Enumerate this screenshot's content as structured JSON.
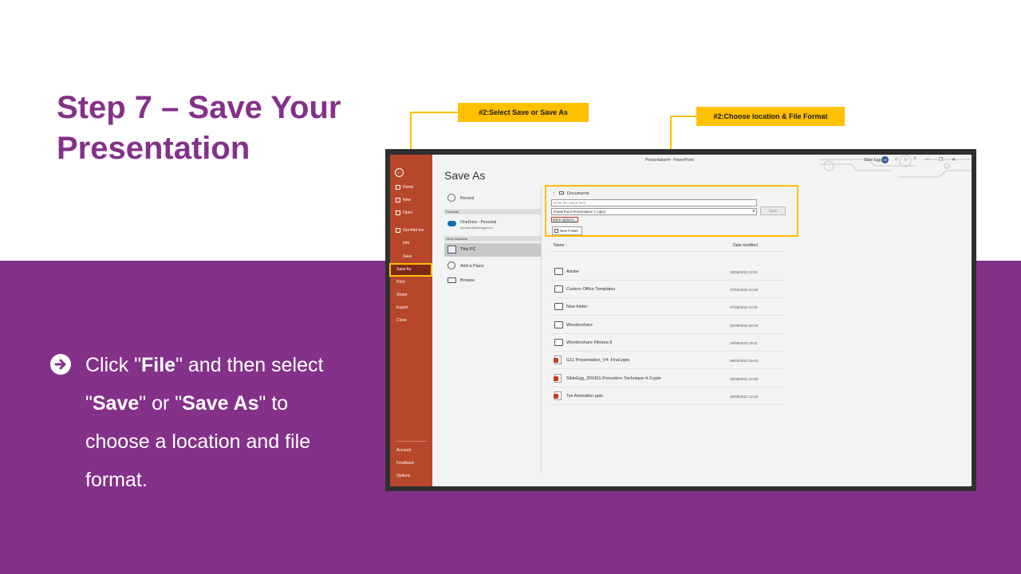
{
  "slide": {
    "title_line1": "Step 7 – Save Your",
    "title_line2": "Presentation",
    "bullet": {
      "part1": "Click \"",
      "bold1": "File",
      "part2": "\" and then select \"",
      "bold2": "Save",
      "part3": "\" or \"",
      "bold3": "Save As",
      "part4": "\" to choose a location and file format."
    }
  },
  "callouts": {
    "first": "#2:Select  Save or Save As",
    "second": "#2:Choose  location & File Format"
  },
  "window": {
    "title": "Presentation4  -  PowerPoint",
    "user_name": "Slide Egg",
    "user_initials": "SE",
    "controls": [
      "☺",
      "⚐",
      "?",
      "–",
      "❐",
      "✕"
    ]
  },
  "backstage": {
    "back_icon": "←",
    "items": [
      "Home",
      "New",
      "Open",
      "Get Add-ins",
      "Info",
      "Save",
      "Save As",
      "Print",
      "Share",
      "Export",
      "Close"
    ],
    "bottom_items": [
      "Account",
      "Feedback",
      "Options"
    ],
    "active": "Save As"
  },
  "save_as": {
    "heading": "Save As",
    "recent": "Recent",
    "personal_header": "Personal",
    "onedrive_name": "OneDrive - Personal",
    "onedrive_email": "arjunan@slideegg.com",
    "other_header": "Other locations",
    "this_pc": "This PC",
    "add_place": "Add a Place",
    "browse": "Browse"
  },
  "location": {
    "up_arrow": "↑",
    "path": "Documents",
    "filename_placeholder": "Enter file name here",
    "filetype": "PowerPoint Presentation (*.pptx)",
    "more_options": "More options...",
    "save_button": "Save",
    "new_folder": "New Folder"
  },
  "file_list": {
    "col_name": "Name ↑",
    "col_date": "Date modified",
    "rows": [
      {
        "name": "Adobe",
        "date": "18/09/2023 13:01",
        "type": "folder"
      },
      {
        "name": "Custom Office Templates",
        "date": "07/02/2023 10:30",
        "type": "folder"
      },
      {
        "name": "New folder",
        "date": "07/09/2023 10:41",
        "type": "folder"
      },
      {
        "name": "Wondershare",
        "date": "20/09/2023 09:39",
        "type": "folder"
      },
      {
        "name": "Wondershare Filmora 9",
        "date": "20/09/2023 19:21",
        "type": "folder"
      },
      {
        "name": "G11 Presentation_V4- Final.pptx",
        "date": "06/03/2023 19:43",
        "type": "pptx"
      },
      {
        "name": "SlideEgg_200431-Pomodoro Technique-4-3.pptx",
        "date": "25/09/2023 10:38",
        "type": "pptx"
      },
      {
        "name": "Tex Animation.pptx",
        "date": "20/09/2023 13:10",
        "type": "pptx"
      }
    ]
  },
  "colors": {
    "purple": "#84318a",
    "callout": "#ffc000",
    "backstage": "#b7472a"
  }
}
